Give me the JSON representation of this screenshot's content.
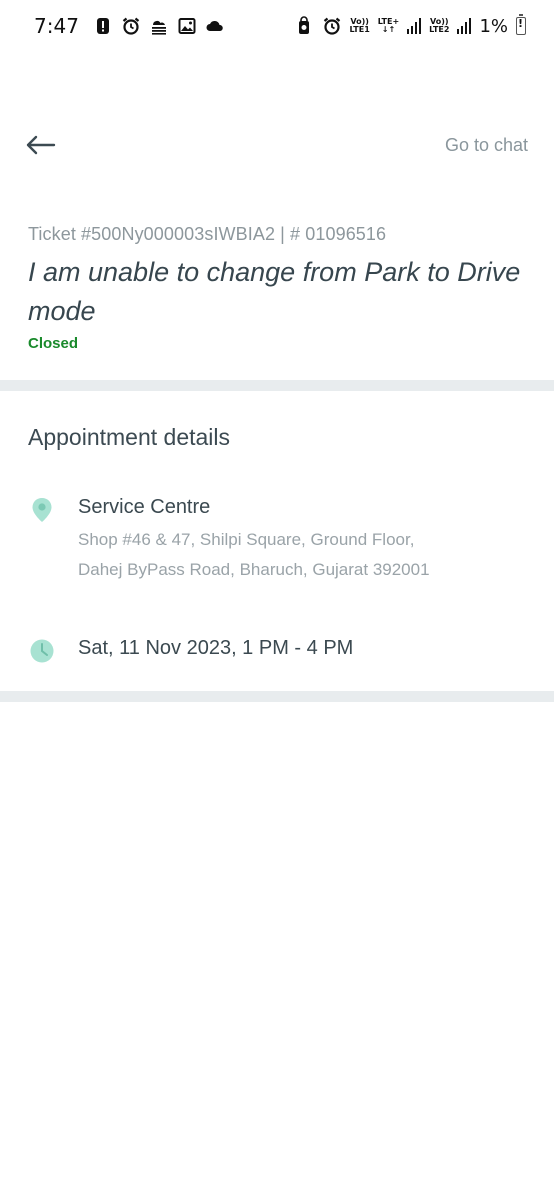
{
  "status_bar": {
    "time": "7:47",
    "left_icons": [
      "alert-icon",
      "alarm-icon",
      "weather-fog-icon",
      "gallery-icon",
      "cloud-icon"
    ],
    "right_icons": [
      "lock-rotate-icon",
      "alarm-icon"
    ],
    "sim1_top": "Vo))",
    "sim1_bottom": "LTE1",
    "sim1_data_top": "LTE+",
    "sim1_data_bottom": "↓↑",
    "sim2_top": "Vo))",
    "sim2_bottom": "LTE2",
    "battery": "1%"
  },
  "header": {
    "back_icon": "arrow-left-icon",
    "go_to_chat": "Go to chat"
  },
  "ticket": {
    "number": "Ticket #500Ny000003sIWBIA2 | # 01096516",
    "title": "I am unable to change from Park to Drive mode",
    "status": "Closed",
    "status_color": "#1a8a2c"
  },
  "appointment": {
    "section_title": "Appointment details",
    "location_icon": "map-pin-icon",
    "location_name": "Service Centre",
    "address": "Shop #46 & 47, Shilpi Square, Ground Floor, Dahej ByPass Road, Bharuch, Gujarat 392001",
    "time_icon": "clock-icon",
    "datetime": "Sat, 11 Nov 2023, 1 PM - 4 PM",
    "accent": "#a8e2d2"
  }
}
